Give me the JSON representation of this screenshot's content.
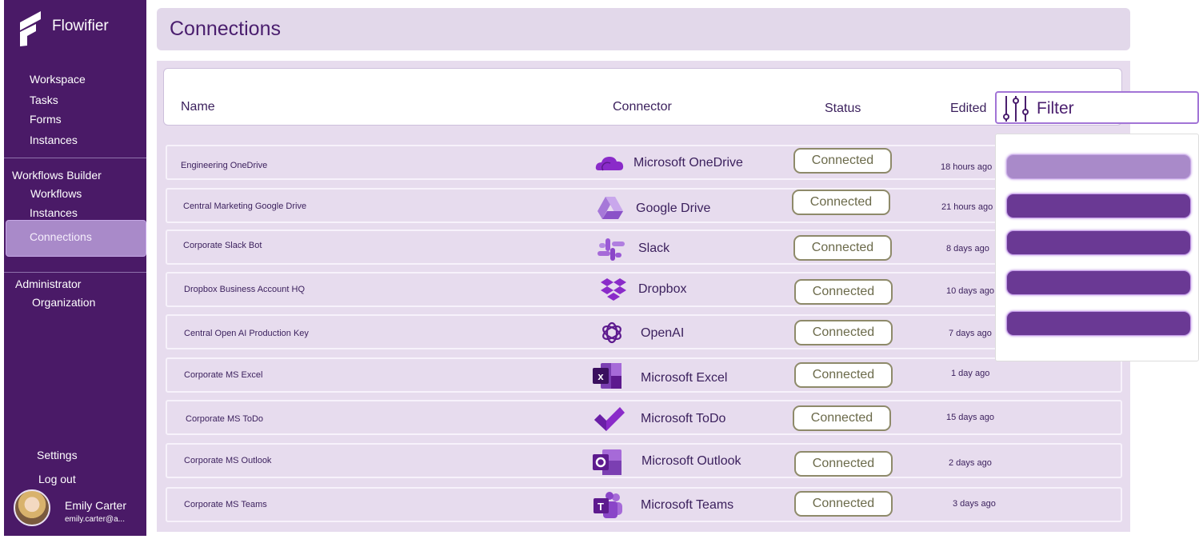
{
  "app": {
    "name": "Flowifier"
  },
  "sidebar": {
    "main_items": [
      {
        "label": "Workspace"
      },
      {
        "label": "Tasks"
      },
      {
        "label": "Forms"
      },
      {
        "label": "Instances"
      }
    ],
    "builder_section": {
      "title": "Workflows Builder",
      "items": [
        {
          "label": "Workflows"
        },
        {
          "label": "Instances"
        },
        {
          "label": "Connections",
          "active": true
        }
      ]
    },
    "admin_section": {
      "title": "Administrator",
      "items": [
        {
          "label": "Organization"
        }
      ]
    },
    "settings_label": "Settings",
    "logout_label": "Log out",
    "user": {
      "name": "Emily Carter",
      "email": "emily.carter@a..."
    }
  },
  "page": {
    "title": "Connections"
  },
  "table": {
    "columns": {
      "name": "Name",
      "connector": "Connector",
      "status": "Status",
      "edited": "Edited"
    },
    "rows": [
      {
        "name": "Engineering OneDrive",
        "connector": "Microsoft OneDrive",
        "icon": "onedrive-icon",
        "status": "Connected",
        "edited": "18 hours ago"
      },
      {
        "name": "Central Marketing Google Drive",
        "connector": "Google Drive",
        "icon": "google-drive-icon",
        "status": "Connected",
        "edited": "21 hours ago"
      },
      {
        "name": "Corporate Slack Bot",
        "connector": "Slack",
        "icon": "slack-icon",
        "status": "Connected",
        "edited": "8 days ago"
      },
      {
        "name": "Dropbox Business Account HQ",
        "connector": "Dropbox",
        "icon": "dropbox-icon",
        "status": "Connected",
        "edited": "10 days ago"
      },
      {
        "name": "Central Open AI Production Key",
        "connector": "OpenAI",
        "icon": "openai-icon",
        "status": "Connected",
        "edited": "7 days ago"
      },
      {
        "name": "Corporate MS Excel",
        "connector": "Microsoft Excel",
        "icon": "excel-icon",
        "status": "Connected",
        "edited": "1 day ago"
      },
      {
        "name": "Corporate MS ToDo",
        "connector": "Microsoft ToDo",
        "icon": "todo-icon",
        "status": "Connected",
        "edited": "15 days ago"
      },
      {
        "name": "Corporate MS Outlook",
        "connector": "Microsoft Outlook",
        "icon": "outlook-icon",
        "status": "Connected",
        "edited": "2 days ago"
      },
      {
        "name": "Corporate MS Teams",
        "connector": "Microsoft Teams",
        "icon": "teams-icon",
        "status": "Connected",
        "edited": "3 days ago"
      }
    ]
  },
  "filter": {
    "label": "Filter",
    "icon": "sliders-icon",
    "option_count_visible": 5
  },
  "colors": {
    "sidebar": "#4a1a67",
    "accent": "#a274d6",
    "panel": "#e7dcee",
    "status_border": "#8e8a6a"
  }
}
